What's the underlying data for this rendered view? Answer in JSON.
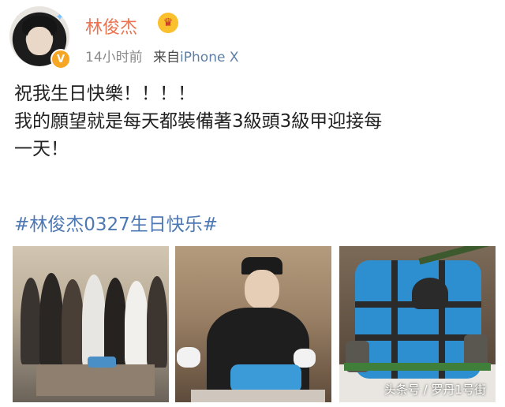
{
  "post": {
    "username": "林俊杰",
    "time": "14小时前",
    "source_prefix": "来自",
    "device": "iPhone X",
    "verified_badge": "V",
    "text": "祝我生日快樂！！！！\n我的願望就是每天都裝備著3級頭3級甲迎接每\n一天！",
    "hashtag": "#林俊杰0327生日快乐#"
  },
  "photos": [
    {
      "subject": "group-photo"
    },
    {
      "subject": "birthday-photo"
    },
    {
      "subject": "cake-photo"
    }
  ],
  "watermark": "头条号 / 罗丹1号街",
  "colors": {
    "username": "#eb7350",
    "hashtag": "#4d78b4",
    "device": "#5d7fa6",
    "meta": "#8a8a8a"
  }
}
